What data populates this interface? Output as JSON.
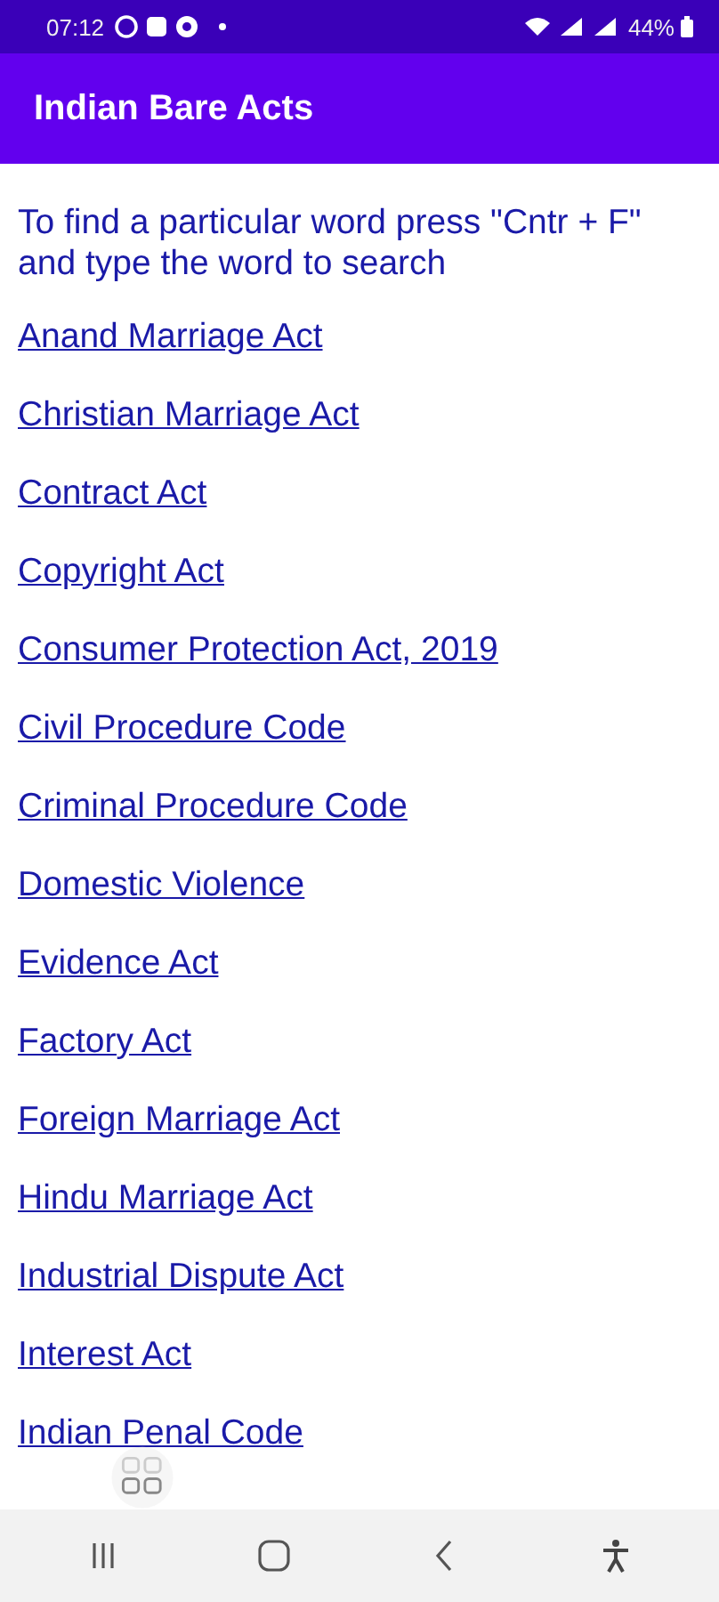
{
  "status_bar": {
    "time": "07:12",
    "battery": "44%"
  },
  "app_bar": {
    "title": "Indian Bare Acts"
  },
  "intro": "To find a particular word press \"Cntr + F\" and type the word to search",
  "links": [
    {
      "label": "Anand Marriage Act"
    },
    {
      "label": "Christian Marriage Act"
    },
    {
      "label": "Contract Act"
    },
    {
      "label": "Copyright Act"
    },
    {
      "label": "Consumer Protection Act, 2019"
    },
    {
      "label": "Civil Procedure Code"
    },
    {
      "label": "Criminal Procedure Code"
    },
    {
      "label": "Domestic Violence"
    },
    {
      "label": "Evidence Act"
    },
    {
      "label": "Factory Act"
    },
    {
      "label": "Foreign Marriage Act"
    },
    {
      "label": "Hindu Marriage Act"
    },
    {
      "label": "Industrial Dispute Act"
    },
    {
      "label": "Interest Act"
    },
    {
      "label": "Indian Penal Code"
    }
  ]
}
